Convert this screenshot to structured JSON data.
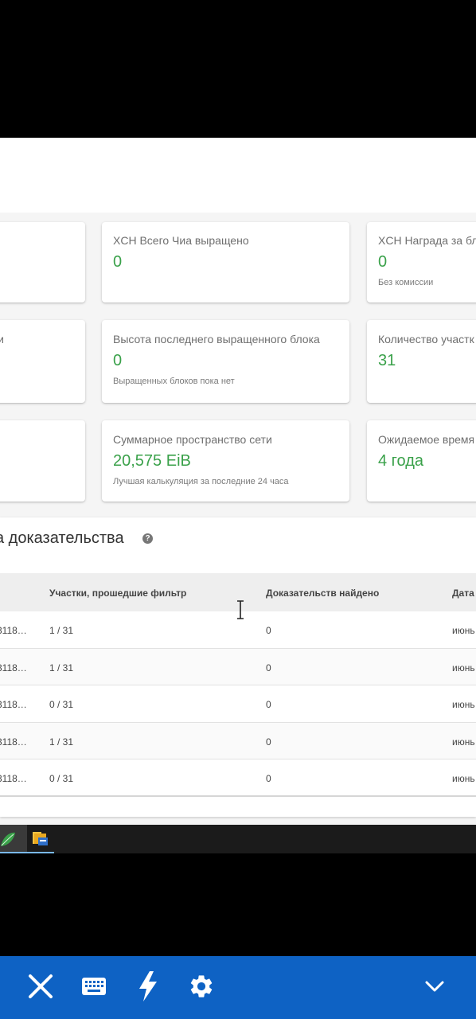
{
  "cards": [
    {
      "title": "",
      "value": "",
      "sub": ""
    },
    {
      "title": "XCH Всего Чиа выращено",
      "value": "0",
      "sub": ""
    },
    {
      "title": "XCH Награда за бл",
      "value": "0",
      "sub": "Без комиссии"
    },
    {
      "title": "и",
      "value": "",
      "sub": ""
    },
    {
      "title": "Высота последнего выращенного блока",
      "value": "0",
      "sub": "Выращенных блоков пока нет"
    },
    {
      "title": "Количество участк",
      "value": "31",
      "sub": ""
    },
    {
      "title": "",
      "value": "",
      "sub": ""
    },
    {
      "title": "Суммарное пространство сети",
      "value": "20,575 EiB",
      "sub": "Лучшая калькуляция за последние 24 часа"
    },
    {
      "title": "Ожидаемое время",
      "value": "4 года",
      "sub": ""
    }
  ],
  "proofs": {
    "title": "а доказательства",
    "help_glyph": "?",
    "columns": [
      "",
      "Участки, прошедшие фильтр",
      "Доказательств найдено",
      "Дата"
    ],
    "rows": [
      [
        "3118…",
        "1 / 31",
        "0",
        "июнь"
      ],
      [
        "3118…",
        "1 / 31",
        "0",
        "июнь"
      ],
      [
        "3118…",
        "0 / 31",
        "0",
        "июнь"
      ],
      [
        "3118…",
        "1 / 31",
        "0",
        "июнь"
      ],
      [
        "3118…",
        "0 / 31",
        "0",
        "июнь"
      ]
    ]
  },
  "taskbar": {
    "apps": [
      {
        "icon": "chia-leaf-icon"
      },
      {
        "icon": "file-explorer-icon"
      }
    ]
  },
  "toolbar": {
    "buttons": [
      "close-icon",
      "keyboard-icon",
      "lightning-icon",
      "gear-icon",
      "chevron-down-icon"
    ]
  },
  "colors": {
    "accent": "#3aa14a",
    "toolbar": "#0e62c4",
    "taskbar": "#1b1b1b"
  }
}
